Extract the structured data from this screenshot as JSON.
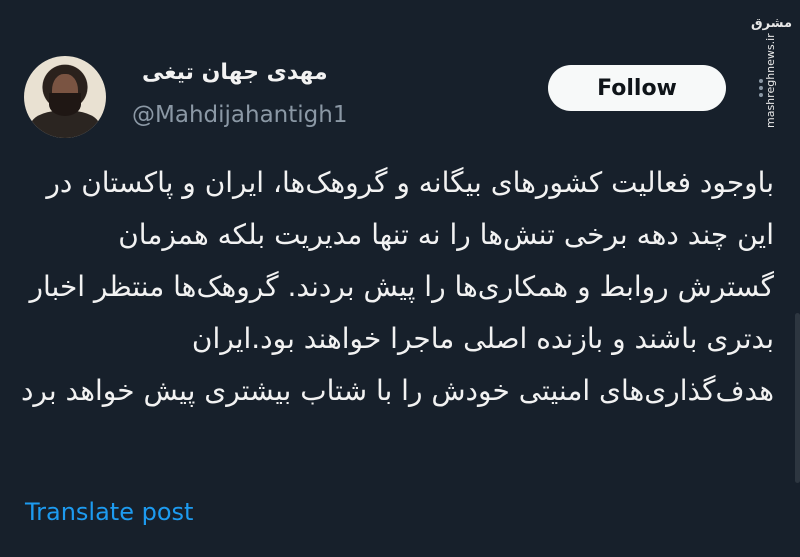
{
  "header": {
    "display_name": "مهدی جهان تیغی",
    "handle": "@Mahdijahantigh1",
    "follow_label": "Follow"
  },
  "tweet": {
    "text": "باوجود فعالیت کشورهای بیگانه و گروهک‌ها، ایران و پاکستان در این چند دهه برخی تنش‌ها را نه تنها مدیریت بلکه همزمان گسترش روابط و همکاری‌ها را پیش بردند. گروهک‌ها منتظر اخبار بدتری باشند و بازنده اصلی ماجرا خواهند بود.ایران هدف‌گذاری‌های امنیتی خودش را با شتاب بیشتری پیش خواهد برد"
  },
  "footer": {
    "translate_label": "Translate post"
  },
  "watermark": {
    "logo_text": "مشرق",
    "url": "mashreghnews.ir"
  },
  "icons": {
    "more": "more-vertical-icon",
    "avatar": "profile-photo"
  },
  "colors": {
    "background": "#17202b",
    "text": "#f2f2f2",
    "muted": "#8b98a5",
    "link": "#1d9bf0",
    "button_bg": "#f7f9f9"
  }
}
